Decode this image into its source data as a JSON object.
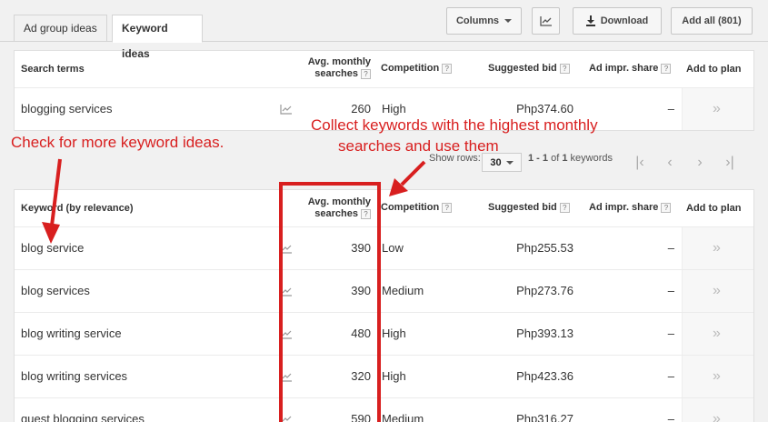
{
  "tabs": [
    "Ad group ideas",
    "Keyword ideas"
  ],
  "toolbar": {
    "columns": "Columns",
    "download": "Download",
    "add_all": "Add all (801)"
  },
  "search_table": {
    "headers": {
      "term": "Search terms",
      "avg": "Avg. monthly searches",
      "competition": "Competition",
      "bid": "Suggested bid",
      "impr": "Ad impr. share",
      "add": "Add to plan"
    },
    "rows": [
      {
        "keyword": "blogging services",
        "avg": "260",
        "competition": "High",
        "bid": "Php374.60",
        "impr": "–"
      }
    ]
  },
  "pager": {
    "show_rows": "Show rows:",
    "rows_value": "30",
    "range": "1 - 1",
    "of": "of",
    "total": "1",
    "unit": "keywords"
  },
  "keyword_table": {
    "headers": {
      "term": "Keyword (by relevance)",
      "avg": "Avg. monthly searches",
      "competition": "Competition",
      "bid": "Suggested bid",
      "impr": "Ad impr. share",
      "add": "Add to plan"
    },
    "rows": [
      {
        "keyword": "blog service",
        "avg": "390",
        "competition": "Low",
        "bid": "Php255.53",
        "impr": "–"
      },
      {
        "keyword": "blog services",
        "avg": "390",
        "competition": "Medium",
        "bid": "Php273.76",
        "impr": "–"
      },
      {
        "keyword": "blog writing service",
        "avg": "480",
        "competition": "High",
        "bid": "Php393.13",
        "impr": "–"
      },
      {
        "keyword": "blog writing services",
        "avg": "320",
        "competition": "High",
        "bid": "Php423.36",
        "impr": "–"
      },
      {
        "keyword": "guest blogging services",
        "avg": "590",
        "competition": "Medium",
        "bid": "Php316.27",
        "impr": "–"
      }
    ]
  },
  "annotations": {
    "left": "Check for more keyword ideas.",
    "right_line1": "Collect keywords with the highest monthly",
    "right_line2": "searches and use them"
  },
  "icons": {
    "chart": "line-chart-icon",
    "download": "download-icon",
    "add": "double-chevron-right-icon"
  },
  "colors": {
    "annotation": "#d81f1f"
  }
}
